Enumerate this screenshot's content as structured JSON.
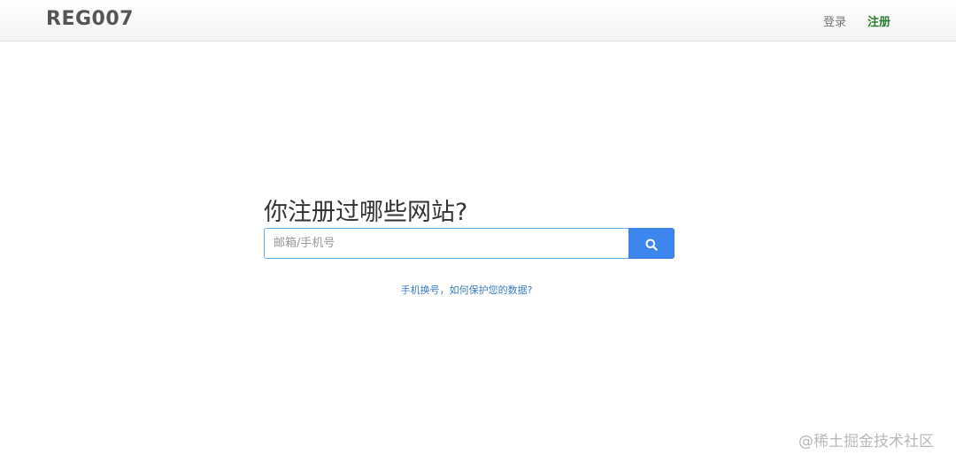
{
  "navbar": {
    "brand": "REG007",
    "login_label": "登录",
    "register_label": "注册",
    "register_color": "#2e7d32"
  },
  "main": {
    "heading": "你注册过哪些网站?",
    "search": {
      "placeholder": "邮箱/手机号",
      "value": "",
      "button_icon": "search-icon",
      "button_color": "#3d86ee"
    },
    "privacy_link": "手机换号，如何保护您的数据?"
  },
  "watermark": "@稀土掘金技术社区"
}
